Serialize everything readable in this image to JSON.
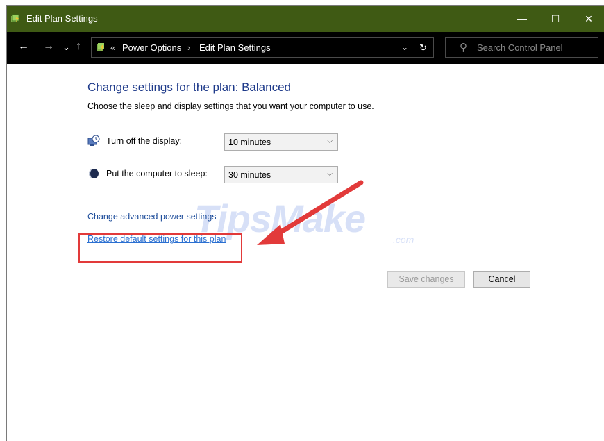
{
  "window": {
    "title": "Edit Plan Settings",
    "controls": {
      "minimize": "—",
      "maximize": "☐",
      "close": "✕"
    }
  },
  "navigation": {
    "back": "←",
    "forward": "→",
    "recent": "⌄",
    "up": "↑",
    "breadcrumb_prefix": "«",
    "breadcrumbs": [
      "Power Options",
      "Edit Plan Settings"
    ],
    "separator": "›",
    "dropdown": "⌄",
    "refresh": "↻"
  },
  "search": {
    "placeholder": "Search Control Panel",
    "icon": "⚲"
  },
  "main": {
    "heading": "Change settings for the plan: Balanced",
    "description": "Choose the sleep and display settings that you want your computer to use.",
    "settings": [
      {
        "label": "Turn off the display:",
        "value": "10 minutes",
        "icon": "display-icon"
      },
      {
        "label": "Put the computer to sleep:",
        "value": "30 minutes",
        "icon": "sleep-icon"
      }
    ],
    "links": {
      "advanced": "Change advanced power settings",
      "restore": "Restore default settings for this plan"
    },
    "buttons": {
      "save": "Save changes",
      "cancel": "Cancel"
    }
  },
  "watermark": {
    "text": "TipsMake",
    "suffix": ".com"
  },
  "colors": {
    "titlebar": "#3f5a14",
    "navbar": "#000000",
    "heading": "#1e3a8a",
    "annotation": "#e23a3a"
  }
}
